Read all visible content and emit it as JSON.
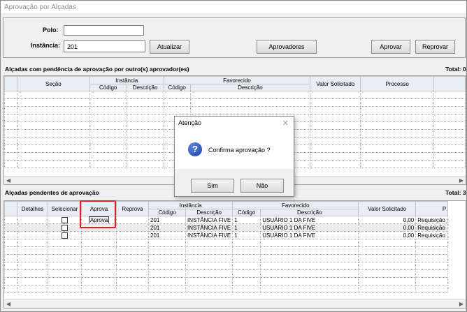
{
  "window": {
    "title": "Aprovação por Alçadas"
  },
  "filters": {
    "polo_label": "Polo:",
    "polo_value": "",
    "instancia_label": "Instância:",
    "instancia_value": "201"
  },
  "buttons": {
    "atualizar": "Atualizar",
    "aprovadores": "Aprovadores",
    "aprovar": "Aprovar",
    "reprovar": "Reprovar"
  },
  "pending_others": {
    "title": "Alçadas com pendência de aprovação por outro(s) aprovador(es)",
    "total": "Total: 0",
    "columns": {
      "secao": "Seção",
      "instancia": "Instância",
      "codigo": "Código",
      "descricao": "Descrição",
      "favorecido": "Favorecido",
      "fav_codigo": "Código",
      "fav_descricao": "Descrição",
      "valor_solicitado": "Valor Solicitado",
      "processo": "Processo"
    }
  },
  "pending_mine": {
    "title": "Alçadas pendentes de aprovação",
    "total": "Total: 3",
    "columns": {
      "detalhes": "Detalhes",
      "selecionar": "Selecionar",
      "aprova": "Aprova",
      "reprova": "Reprova",
      "instancia": "Instância",
      "codigo": "Código",
      "descricao": "Descrição",
      "fav_codigo": "Código",
      "favorecido": "Favorecido",
      "fav_descricao": "Descrição",
      "valor_solicitado": "Valor Solicitado",
      "processo": "P"
    },
    "aprova_cell": "Aprova",
    "rows": [
      {
        "codigo": "201",
        "descricao": "INSTÂNCIA FIVE",
        "fav_codigo": "1",
        "fav_descricao": "USUÁRIO 1 DA FIVE",
        "valor": "0,00",
        "processo": "Requisição"
      },
      {
        "codigo": "201",
        "descricao": "INSTÂNCIA FIVE",
        "fav_codigo": "1",
        "fav_descricao": "USUÁRIO 1 DA FIVE",
        "valor": "0,00",
        "processo": "Requisição"
      },
      {
        "codigo": "201",
        "descricao": "INSTÂNCIA FIVE",
        "fav_codigo": "1",
        "fav_descricao": "USUÁRIO 1 DA FIVE",
        "valor": "0,00",
        "processo": "Requisição"
      }
    ]
  },
  "dialog": {
    "title": "Atenção",
    "close": "✕",
    "icon": "question-icon",
    "message": "Confirma aprovação ?",
    "sim": "Sim",
    "nao": "Não"
  }
}
